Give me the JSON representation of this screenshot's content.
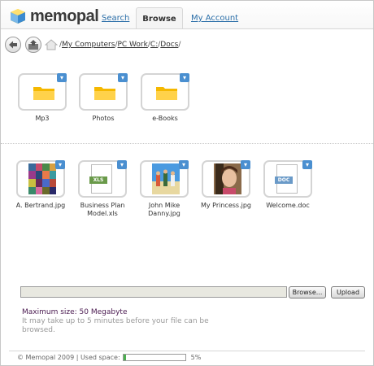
{
  "header": {
    "logo_text": "memopal",
    "tabs": [
      {
        "label": "Search"
      },
      {
        "label": "Browse"
      },
      {
        "label": "My Account"
      }
    ]
  },
  "breadcrumb": {
    "items": [
      "My Computers",
      "PC Work",
      "C:",
      "Docs"
    ]
  },
  "folders": [
    {
      "label": "Mp3"
    },
    {
      "label": "Photos"
    },
    {
      "label": "e-Books"
    }
  ],
  "files": [
    {
      "label": "A. Bertrand.jpg",
      "icon": "mosaic-image-thumbnail"
    },
    {
      "label": "Business Plan Model.xls",
      "icon": "xls-file-icon",
      "badge": "XLS",
      "badge_color": "#6a9a4a"
    },
    {
      "label": "John Mike Danny.jpg",
      "icon": "beach-photo-thumbnail"
    },
    {
      "label": "My Princess.jpg",
      "icon": "portrait-photo-thumbnail"
    },
    {
      "label": "Welcome.doc",
      "icon": "doc-file-icon",
      "badge": "DOC",
      "badge_color": "#6a9ac8"
    }
  ],
  "upload": {
    "browse_label": "Browse...",
    "upload_label": "Upload",
    "max_size": "Maximum size: 50 Megabyte",
    "note": "It may take up to 5 minutes before your file can be browsed."
  },
  "footer": {
    "copyright": "© Memopal 2009 | Used space:",
    "used_percent": 5,
    "used_label": "5%"
  },
  "colors": {
    "accent": "#4a8fd0",
    "folder": "#f5b800",
    "link": "#2a6ea8"
  }
}
